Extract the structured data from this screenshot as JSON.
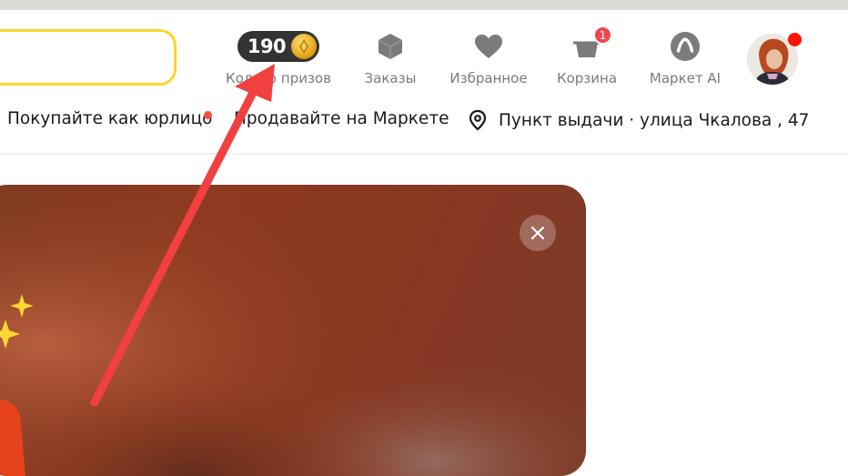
{
  "header": {
    "coins": {
      "count": "190",
      "label": "Колесо призов"
    },
    "orders": {
      "label": "Заказы"
    },
    "favorites": {
      "label": "Избранное"
    },
    "cart": {
      "label": "Корзина",
      "badge": "1"
    },
    "ai": {
      "label": "Маркет AI"
    }
  },
  "subnav": {
    "business": "Покупайте как юрлицо",
    "sell": "Продавайте на Маркете",
    "pickup": "Пункт выдачи · улица Чкалова , 47"
  },
  "colors": {
    "search_border": "#fed42b",
    "pill": "#333333",
    "coin": "#e5a71a",
    "badge": "#f1474a",
    "banner": "#8a3a20",
    "arrow": "#f24040",
    "sparkle": "#ffd633"
  },
  "icons": [
    "coin-icon",
    "box-icon",
    "heart-icon",
    "cart-icon",
    "ai-icon",
    "location-icon",
    "close-icon",
    "sparkle-icon"
  ]
}
